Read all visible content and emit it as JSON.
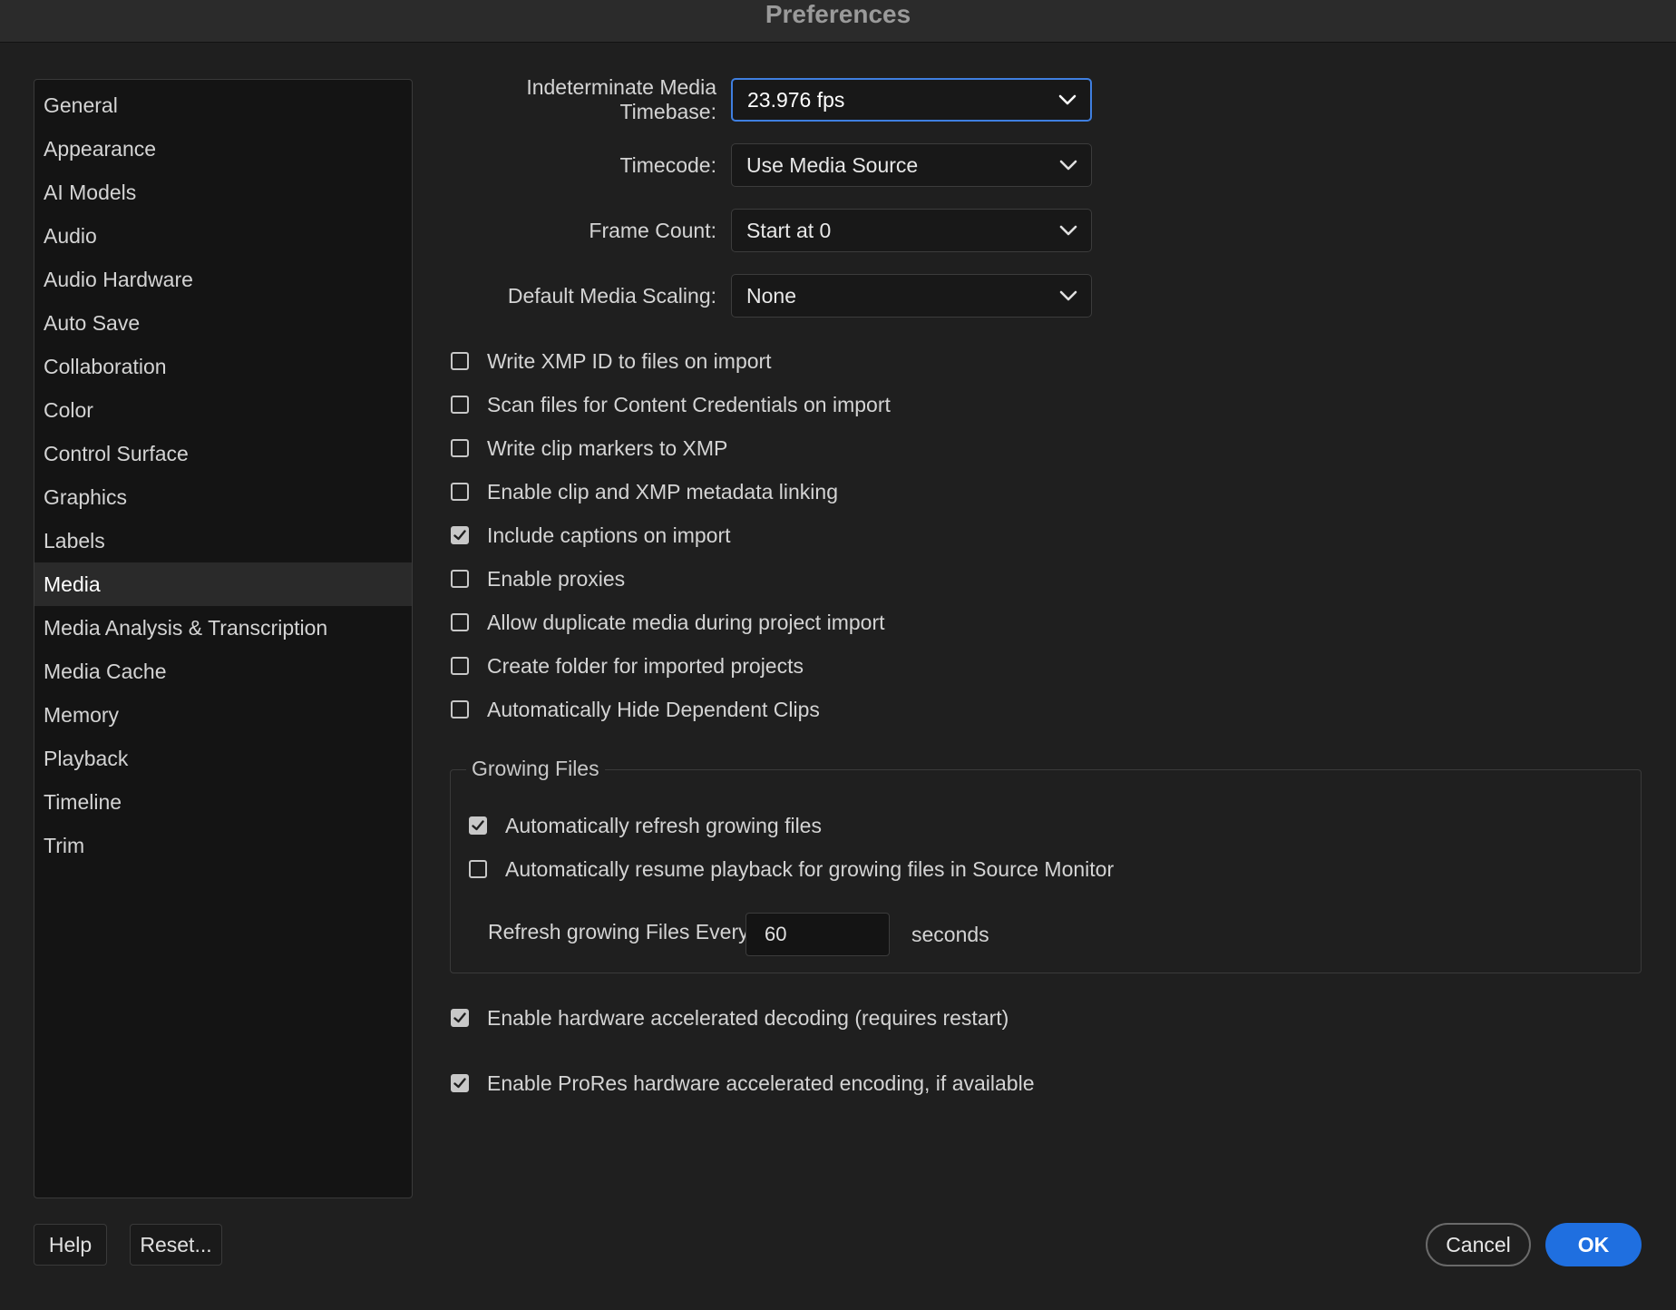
{
  "window": {
    "title": "Preferences"
  },
  "sidebar": {
    "items": [
      {
        "label": "General"
      },
      {
        "label": "Appearance"
      },
      {
        "label": "AI Models"
      },
      {
        "label": "Audio"
      },
      {
        "label": "Audio Hardware"
      },
      {
        "label": "Auto Save"
      },
      {
        "label": "Collaboration"
      },
      {
        "label": "Color"
      },
      {
        "label": "Control Surface"
      },
      {
        "label": "Graphics"
      },
      {
        "label": "Labels"
      },
      {
        "label": "Media",
        "active": true
      },
      {
        "label": "Media Analysis & Transcription"
      },
      {
        "label": "Media Cache"
      },
      {
        "label": "Memory"
      },
      {
        "label": "Playback"
      },
      {
        "label": "Timeline"
      },
      {
        "label": "Trim"
      }
    ]
  },
  "media": {
    "timebase": {
      "label": "Indeterminate Media Timebase:",
      "value": "23.976 fps"
    },
    "timecode": {
      "label": "Timecode:",
      "value": "Use Media Source"
    },
    "frame_count": {
      "label": "Frame Count:",
      "value": "Start at 0"
    },
    "scaling": {
      "label": "Default Media Scaling:",
      "value": "None"
    },
    "checkboxes": [
      {
        "label": "Write XMP ID to files on import",
        "checked": false
      },
      {
        "label": "Scan files for Content Credentials on import",
        "checked": false
      },
      {
        "label": "Write clip markers to XMP",
        "checked": false
      },
      {
        "label": "Enable clip and XMP metadata linking",
        "checked": false
      },
      {
        "label": "Include captions on import",
        "checked": true
      },
      {
        "label": "Enable proxies",
        "checked": false
      },
      {
        "label": "Allow duplicate media during project import",
        "checked": false
      },
      {
        "label": "Create folder for imported projects",
        "checked": false
      },
      {
        "label": "Automatically Hide Dependent Clips",
        "checked": false
      }
    ],
    "growing_files": {
      "legend": "Growing Files",
      "auto_refresh": {
        "label": "Automatically refresh growing files",
        "checked": true
      },
      "auto_resume": {
        "label": "Automatically resume playback for growing files in Source Monitor",
        "checked": false
      },
      "refresh_label": "Refresh growing Files Every",
      "refresh_value": "60",
      "refresh_unit": "seconds"
    },
    "hw_decoding": {
      "label": "Enable hardware accelerated decoding (requires restart)",
      "checked": true
    },
    "prores_encoding": {
      "label": "Enable ProRes hardware accelerated encoding, if available",
      "checked": true
    }
  },
  "buttons": {
    "help": "Help",
    "reset": "Reset...",
    "cancel": "Cancel",
    "ok": "OK"
  },
  "colors": {
    "accent": "#1f6fe0",
    "focus_ring": "#3f7fe0",
    "background": "#1f1f1f"
  },
  "icons": {
    "dropdown": "chevron-down-icon",
    "check": "checkmark-icon"
  }
}
